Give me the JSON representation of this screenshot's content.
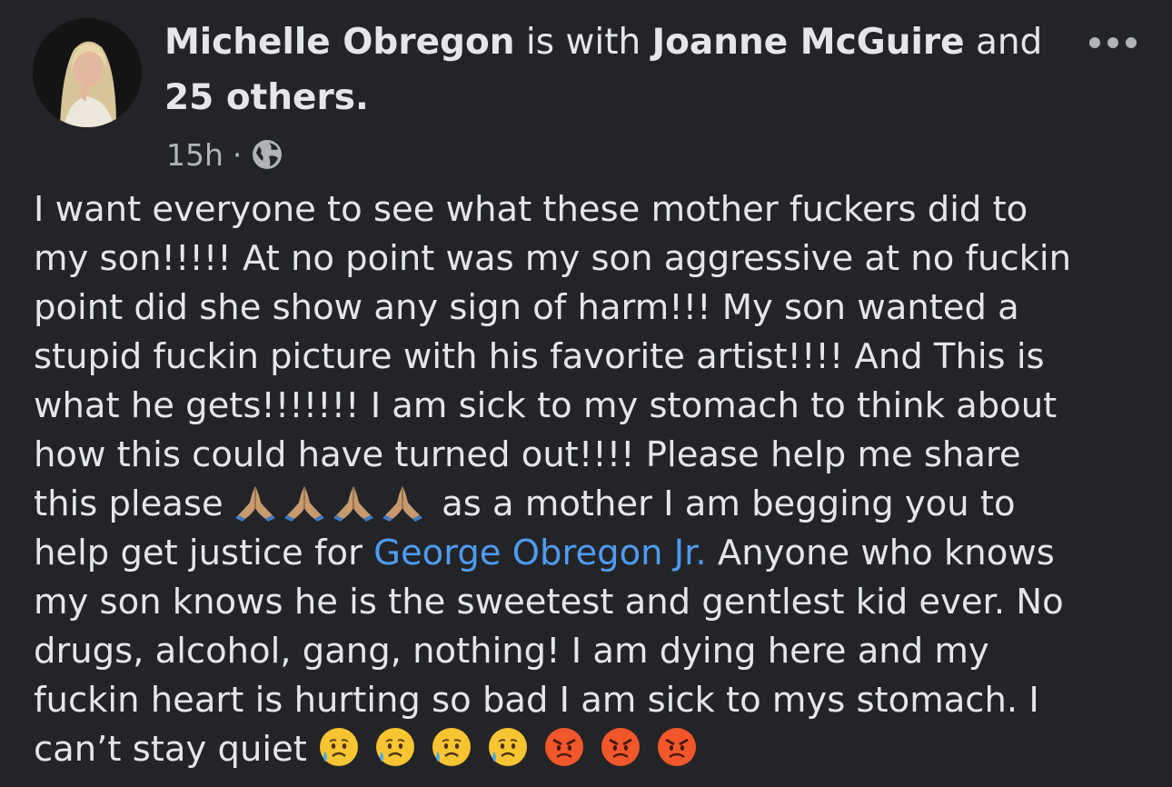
{
  "post": {
    "author": "Michelle Obregon",
    "with_text": " is with ",
    "tagged_person": "Joanne McGuire",
    "and_text": " and",
    "others": "25 others.",
    "time": "15h",
    "separator": "·",
    "privacy_icon": "globe-icon",
    "more_icon": "more-options-icon",
    "body": {
      "lines": [
        "I want everyone to see what these mother fuckers did to",
        "my son!!!!! At no point was my son aggressive at no fuckin",
        "point did she show any sign of harm!!! My son wanted a",
        "stupid fuckin picture with his favorite artist!!!! And This is",
        "what he gets!!!!!!! I am sick to my stomach to think about",
        "how this could have turned out!!!! Please help me share"
      ],
      "line7_start": "this please",
      "line7_end": "as a mother I am begging you to",
      "line8_start": "help get justice for ",
      "mention": "George Obregon Jr.",
      "line8_end": " Anyone who knows",
      "lines_after": [
        "my son knows he is the sweetest and gentlest kid ever. No",
        "drugs, alcohol, gang, nothing! I am dying here and my",
        "fuckin heart is hurting so bad I am sick to mys stomach. I"
      ],
      "last_line": "can’t stay quiet",
      "pray_emojis": [
        "folded-hands-emoji",
        "folded-hands-emoji",
        "folded-hands-emoji",
        "folded-hands-emoji"
      ],
      "end_emojis": [
        "sad-sweat-face-emoji",
        "sad-sweat-face-emoji",
        "sad-sweat-face-emoji",
        "sad-sweat-face-emoji",
        "angry-face-emoji",
        "angry-face-emoji",
        "angry-face-emoji"
      ]
    }
  },
  "colors": {
    "background": "#232427",
    "text": "#e4e6eb",
    "secondary": "#b0b3b8",
    "link": "#4e9bf3"
  }
}
